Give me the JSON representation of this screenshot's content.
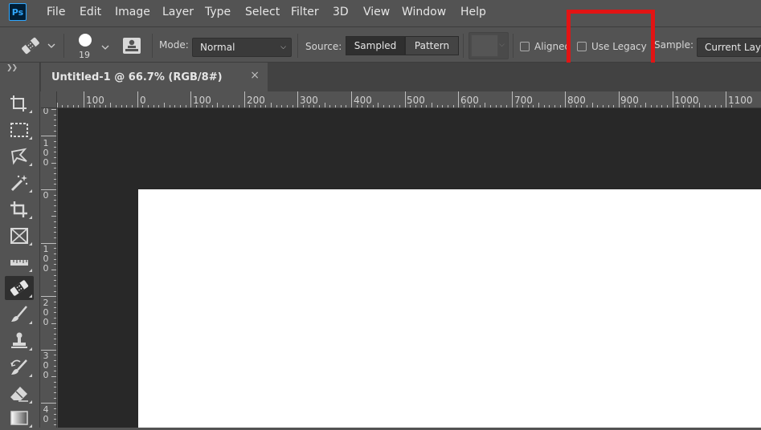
{
  "app": {
    "logo_text": "Ps"
  },
  "menu": [
    "File",
    "Edit",
    "Image",
    "Layer",
    "Type",
    "Select",
    "Filter",
    "3D",
    "View",
    "Window",
    "Help"
  ],
  "options": {
    "tool_icon": "spot-healing-brush-icon",
    "brush_size": "19",
    "mode_label": "Mode:",
    "mode_value": "Normal",
    "source_label": "Source:",
    "source_options": [
      "Sampled",
      "Pattern"
    ],
    "source_selected": "Sampled",
    "aligned_label": "Aligned",
    "aligned_checked": false,
    "use_legacy_label": "Use Legacy",
    "use_legacy_checked": false,
    "sample_label": "Sample:",
    "sample_value": "Current Layer",
    "highlight_color": "#e21414"
  },
  "document_tab": {
    "title": "Untitled-1 @ 66.7% (RGB/8#)",
    "close_glyph": "×"
  },
  "ruler": {
    "top_labels": [
      "100",
      "0",
      "100",
      "200",
      "300",
      "400",
      "500",
      "600",
      "700",
      "800",
      "900",
      "1000",
      "1100"
    ],
    "left_labels": [
      "0",
      "100",
      "0",
      "100",
      "200",
      "300",
      "40"
    ]
  },
  "tools": [
    {
      "name": "artboard-tool-icon",
      "active": false
    },
    {
      "name": "rectangular-marquee-tool-icon",
      "active": false
    },
    {
      "name": "lasso-tool-icon",
      "active": false
    },
    {
      "name": "magic-wand-tool-icon",
      "active": false
    },
    {
      "name": "crop-tool-icon",
      "active": false
    },
    {
      "name": "frame-tool-icon",
      "active": false
    },
    {
      "name": "ruler-tool-icon",
      "active": false
    },
    {
      "name": "healing-brush-tool-icon",
      "active": true
    },
    {
      "name": "brush-tool-icon",
      "active": false
    },
    {
      "name": "clone-stamp-tool-icon",
      "active": false
    },
    {
      "name": "history-brush-tool-icon",
      "active": false
    },
    {
      "name": "eraser-tool-icon",
      "active": false
    },
    {
      "name": "gradient-tool-icon",
      "active": false
    }
  ],
  "colors": {
    "ui_bg": "#535353",
    "canvas_bg": "#282828",
    "document_bg": "#ffffff"
  }
}
